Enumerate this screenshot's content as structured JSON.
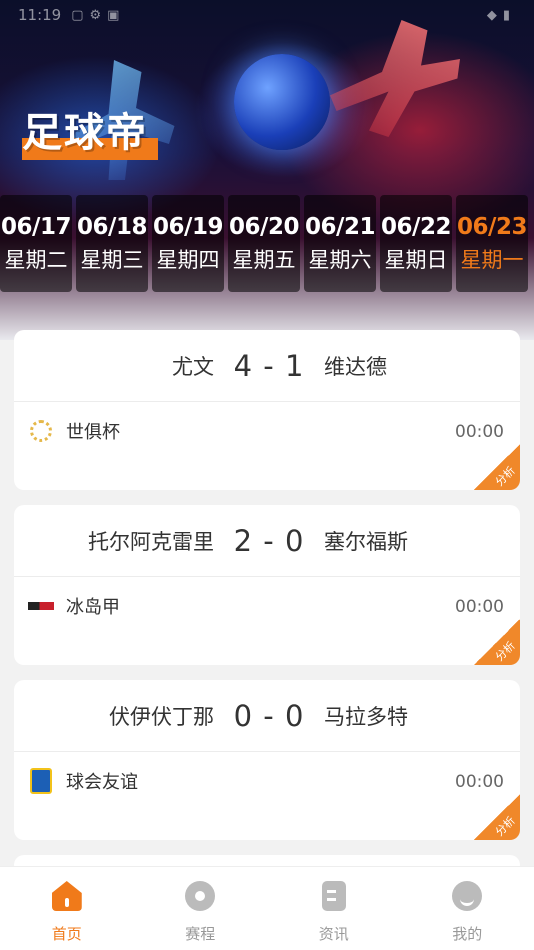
{
  "status_bar": {
    "time": "11:19",
    "left_icons": [
      "app-icon",
      "settings-icon",
      "notification-icon"
    ],
    "right_icons": [
      "wifi-icon",
      "battery-icon"
    ]
  },
  "app": {
    "logo_text": "足球帝"
  },
  "colors": {
    "accent": "#f07a1a",
    "inactive": "#999999"
  },
  "dates": [
    {
      "date": "06/17",
      "weekday": "星期二",
      "active": false
    },
    {
      "date": "06/18",
      "weekday": "星期三",
      "active": false
    },
    {
      "date": "06/19",
      "weekday": "星期四",
      "active": false
    },
    {
      "date": "06/20",
      "weekday": "星期五",
      "active": false
    },
    {
      "date": "06/21",
      "weekday": "星期六",
      "active": false
    },
    {
      "date": "06/22",
      "weekday": "星期日",
      "active": false
    },
    {
      "date": "06/23",
      "weekday": "星期一",
      "active": true
    }
  ],
  "matches": [
    {
      "home": "尤文",
      "score": "4 - 1",
      "away": "维达德",
      "league": "世俱杯",
      "league_icon": "trophy-ring-icon",
      "time": "00:00",
      "analysis_label": "分析"
    },
    {
      "home": "托尔阿克雷里",
      "score": "2 - 0",
      "away": "塞尔福斯",
      "league": "冰岛甲",
      "league_icon": "league-logo-icon",
      "time": "00:00",
      "analysis_label": "分析"
    },
    {
      "home": "伏伊伏丁那",
      "score": "0 - 0",
      "away": "马拉多特",
      "league": "球会友谊",
      "league_icon": "club-badge-icon",
      "time": "00:00",
      "analysis_label": "分析"
    }
  ],
  "nav": [
    {
      "label": "首页",
      "icon": "home-icon",
      "active": true
    },
    {
      "label": "赛程",
      "icon": "schedule-icon",
      "active": false
    },
    {
      "label": "资讯",
      "icon": "news-icon",
      "active": false
    },
    {
      "label": "我的",
      "icon": "profile-icon",
      "active": false
    }
  ]
}
